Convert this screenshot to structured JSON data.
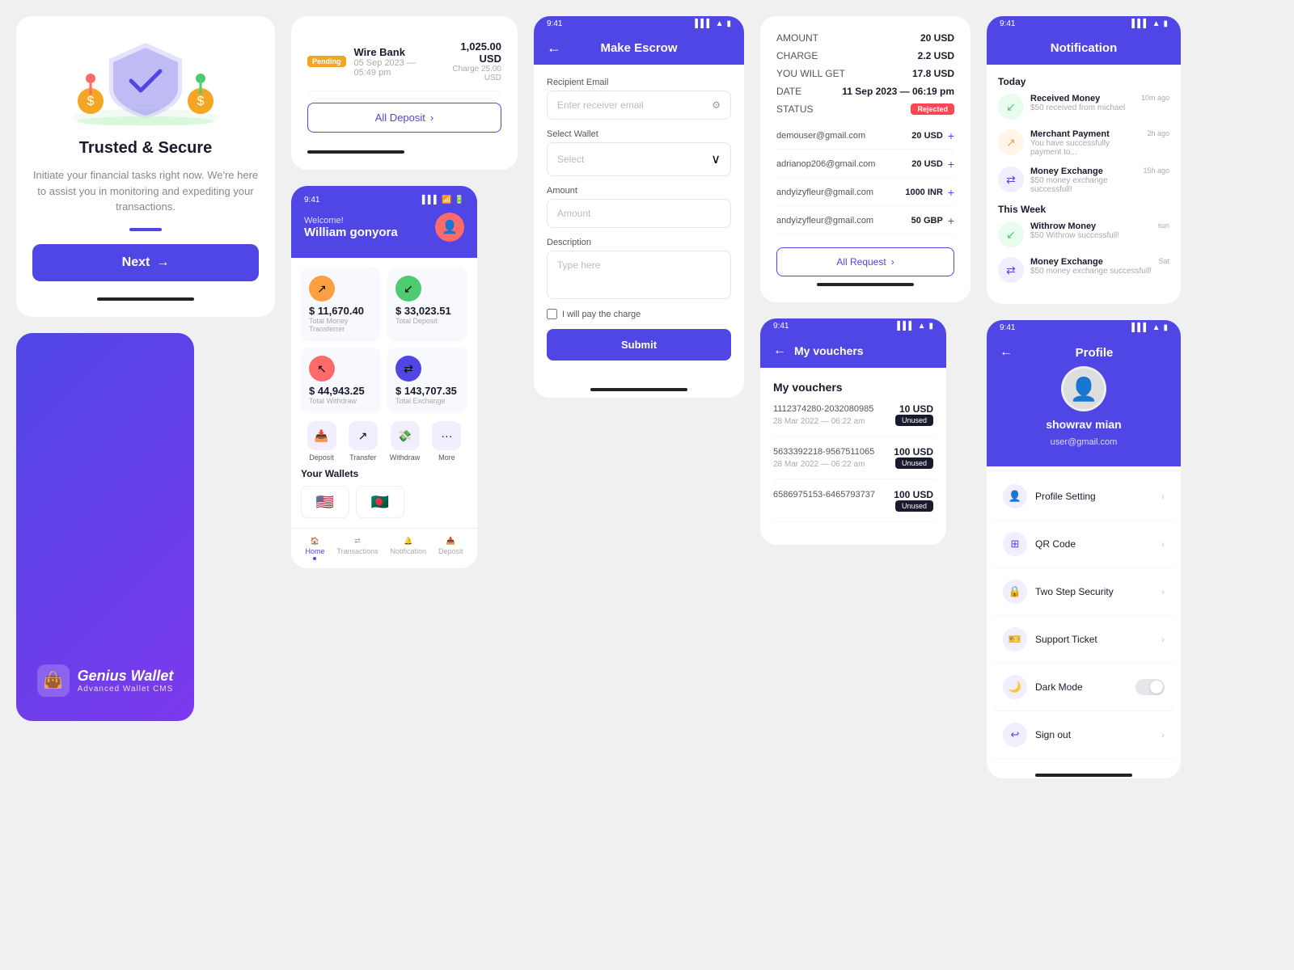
{
  "trusted": {
    "title": "Trusted & Secure",
    "description": "Initiate your financial tasks right now. We're here to assist you in monitoring and expediting your transactions.",
    "next_label": "Next",
    "swipe_bar": true
  },
  "deposit_card": {
    "item": {
      "badge": "Pending",
      "bank": "Wire Bank",
      "date": "05 Sep 2023 — 05:49 pm",
      "amount": "1,025.00 USD",
      "charge": "Charge 25.00 USD"
    },
    "all_deposit_label": "All Deposit"
  },
  "dashboard": {
    "time": "9:41",
    "welcome": "Welcome!",
    "username": "William gonyora",
    "stats": [
      {
        "label": "Total Money Transferrer",
        "amount": "$ 11,670.40",
        "icon": "↗",
        "color": "orange"
      },
      {
        "label": "Total Deposit",
        "amount": "$ 33,023.51",
        "icon": "↙",
        "color": "green"
      },
      {
        "label": "Total Withdraw",
        "amount": "$ 44,943.25",
        "icon": "↖",
        "color": "red"
      },
      {
        "label": "Total Exchange",
        "amount": "$ 143,707.35",
        "icon": "⇄",
        "color": "blue"
      }
    ],
    "quick_actions": [
      {
        "label": "Deposit",
        "icon": "📥"
      },
      {
        "label": "Transfer",
        "icon": "↗"
      },
      {
        "label": "Withdraw",
        "icon": "💸"
      },
      {
        "label": "More",
        "icon": "···"
      }
    ],
    "wallets_title": "Your Wallets",
    "wallet_flags": [
      "🇺🇸",
      "🇧🇩"
    ],
    "nav_items": [
      {
        "label": "Home",
        "icon": "🏠",
        "active": true
      },
      {
        "label": "Transactions",
        "icon": "⇄",
        "active": false
      },
      {
        "label": "Notification",
        "icon": "🔔",
        "active": false
      },
      {
        "label": "Deposit",
        "icon": "📥",
        "active": false
      }
    ]
  },
  "brand": {
    "name": "Genius Wallet",
    "subtitle": "Advanced Wallet CMS"
  },
  "escrow": {
    "time": "9:41",
    "title": "Make Escrow",
    "recipient_email_label": "Recipient Email",
    "recipient_email_placeholder": "Enter receiver email",
    "select_wallet_label": "Select Wallet",
    "select_wallet_placeholder": "Select",
    "amount_label": "Amount",
    "amount_placeholder": "Amount",
    "description_label": "Description",
    "description_placeholder": "Type here",
    "charge_label": "I will pay the charge",
    "submit_label": "Submit"
  },
  "summary": {
    "rows": [
      {
        "key": "AMOUNT",
        "value": "20 USD"
      },
      {
        "key": "CHARGE",
        "value": "2.2 USD"
      },
      {
        "key": "YOU WILL GET",
        "value": "17.8 USD"
      },
      {
        "key": "DATE",
        "value": "11 Sep 2023 — 06:19 pm"
      },
      {
        "key": "STATUS",
        "value": "Rejected",
        "is_badge": true
      }
    ],
    "requests": [
      {
        "email": "demouser@gmail.com",
        "amount": "20 USD"
      },
      {
        "email": "adrianop206@gmail.com",
        "amount": "20 USD"
      },
      {
        "email": "andyizyfleur@gmail.com",
        "amount": "1000 INR"
      },
      {
        "email": "andyizyfleur@gmail.com",
        "amount": "50 GBP"
      }
    ],
    "all_request_label": "All Request"
  },
  "vouchers": {
    "time": "9:41",
    "title": "My vouchers",
    "section_title": "My vouchers",
    "items": [
      {
        "code": "1112374280-2032080985",
        "amount": "10 USD",
        "date": "28 Mar 2022 — 06:22 am",
        "status": "Unused"
      },
      {
        "code": "5633392218-9567511065",
        "amount": "100 USD",
        "date": "28 Mar 2022 — 06:22 am",
        "status": "Unused"
      },
      {
        "code": "6586975153-6465793737",
        "amount": "100 USD",
        "date": "",
        "status": "Unused"
      }
    ]
  },
  "notification": {
    "time": "9:41",
    "title": "Notification",
    "today_label": "Today",
    "this_week_label": "This Week",
    "items_today": [
      {
        "title": "Received Money",
        "desc": "$50 received from michael",
        "time": "10m ago",
        "type": "green"
      },
      {
        "title": "Merchant Payment",
        "desc": "You have successfully payment to...",
        "time": "2h ago",
        "type": "orange"
      },
      {
        "title": "Money Exchange",
        "desc": "$50 money exchange successfull!",
        "time": "15h ago",
        "type": "purple"
      }
    ],
    "items_week": [
      {
        "title": "Withrow Money",
        "desc": "$50 Withrow successfull!",
        "time": "sun",
        "type": "green"
      },
      {
        "title": "Money Exchange",
        "desc": "$50 money exchange successfull!",
        "time": "Sat",
        "type": "purple"
      }
    ]
  },
  "profile": {
    "time": "9:41",
    "title": "Profile",
    "name": "showrav mian",
    "email": "user@gmail.com",
    "menu_items": [
      {
        "label": "Profile Setting",
        "icon": "👤",
        "type": "chevron"
      },
      {
        "label": "QR Code",
        "icon": "⊞",
        "type": "chevron"
      },
      {
        "label": "Two Step Security",
        "icon": "🔒",
        "type": "chevron"
      },
      {
        "label": "Support Ticket",
        "icon": "🎫",
        "type": "chevron"
      },
      {
        "label": "Dark Mode",
        "icon": "🌙",
        "type": "toggle"
      },
      {
        "label": "Sign out",
        "icon": "↩",
        "type": "chevron"
      }
    ]
  }
}
